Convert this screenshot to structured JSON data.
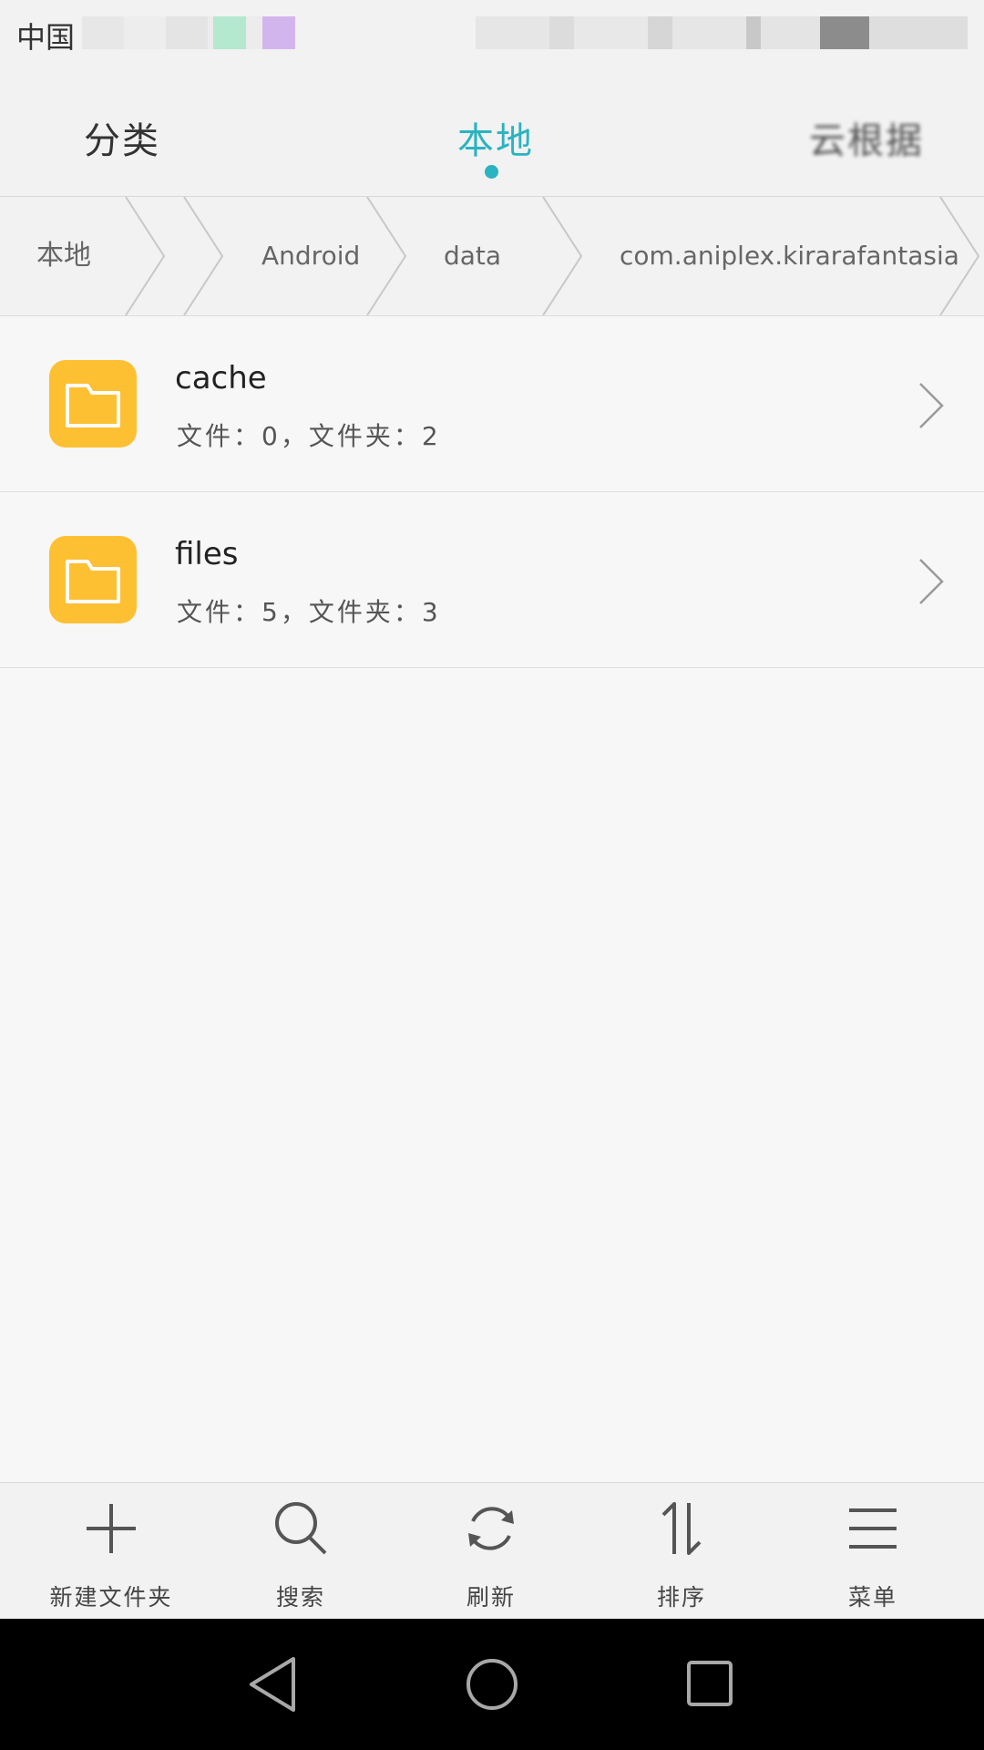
{
  "status_bar": {
    "carrier": "中国"
  },
  "tabs": [
    {
      "label": "分类",
      "active": false
    },
    {
      "label": "本地",
      "active": true
    },
    {
      "label": "云根据",
      "active": false
    }
  ],
  "breadcrumb": [
    "本地",
    "",
    "Android",
    "data",
    "com.aniplex.kirarafantasia"
  ],
  "files": [
    {
      "name": "cache",
      "meta": "文件：0，文件夹：2",
      "icon": "folder-icon"
    },
    {
      "name": "files",
      "meta": "文件：5，文件夹：3",
      "icon": "folder-icon"
    }
  ],
  "toolbar": [
    {
      "label": "新建文件夹",
      "icon": "plus-icon"
    },
    {
      "label": "搜索",
      "icon": "search-icon"
    },
    {
      "label": "刷新",
      "icon": "refresh-icon"
    },
    {
      "label": "排序",
      "icon": "sort-icon"
    },
    {
      "label": "菜单",
      "icon": "menu-icon"
    }
  ],
  "colors": {
    "accent": "#2ab3c0",
    "folder": "#fec033"
  }
}
